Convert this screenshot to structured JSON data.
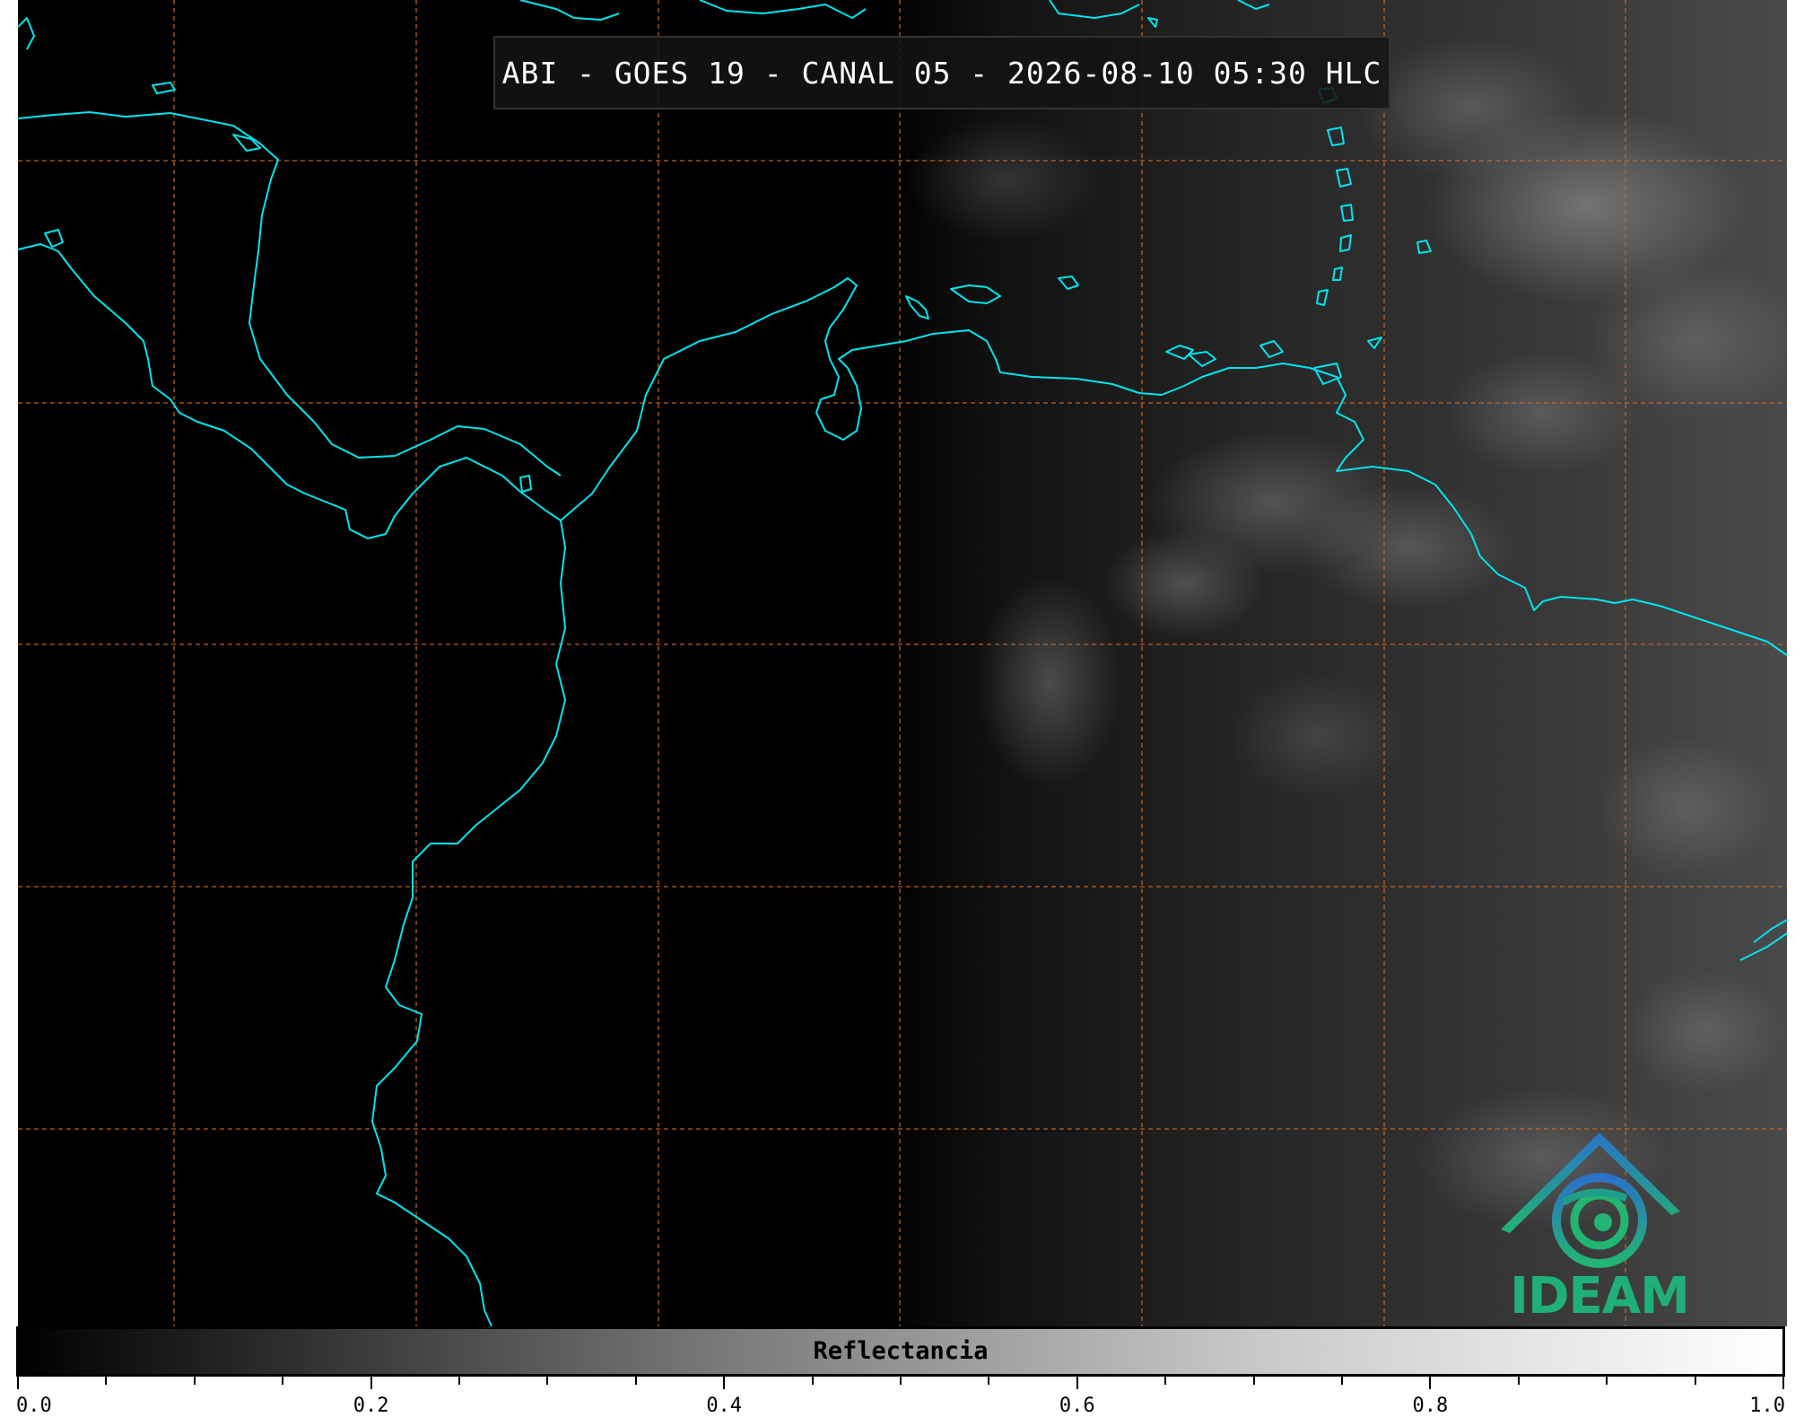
{
  "title": "ABI - GOES 19 - CANAL 05 - 2026-08-10 05:30 HLC",
  "logo": {
    "text": "IDEAM",
    "icon": "ideam-mountain-swirl-icon"
  },
  "colorbar": {
    "label": "Reflectancia",
    "min": 0.0,
    "max": 1.0,
    "major_ticks": [
      "0.0",
      "0.2",
      "0.4",
      "0.6",
      "0.8",
      "1.0"
    ],
    "minor_step": 0.05
  },
  "colors": {
    "coastline": "#00e5ee",
    "grid": "#d2691e",
    "background": "#000000"
  }
}
